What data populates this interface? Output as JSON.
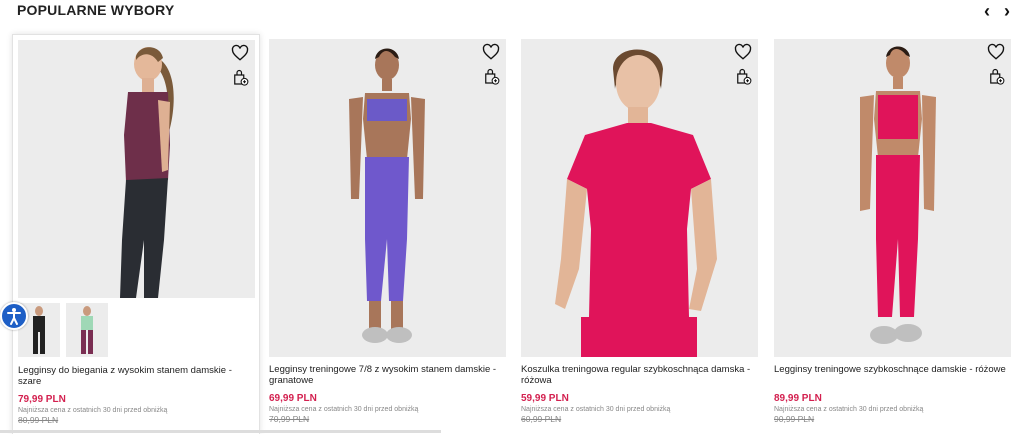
{
  "section": {
    "title": "POPULARNE WYBORY"
  },
  "nav": {
    "prev_icon": "chevron-left-icon",
    "next_icon": "chevron-right-icon"
  },
  "products": [
    {
      "name": "Legginsy do biegania z wysokim stanem damskie - szare",
      "price": "79,99 PLN",
      "lowest_note": "Najniższa cena z ostatnich 30 dni przed obniżką",
      "old_price": "80,99 PLN",
      "has_thumbs": true
    },
    {
      "name": "Legginsy treningowe 7/8 z wysokim stanem damskie - granatowe",
      "price": "69,99 PLN",
      "lowest_note": "Najniższa cena z ostatnich 30 dni przed obniżką",
      "old_price": "70,99 PLN"
    },
    {
      "name": "Koszulka treningowa regular szybkoschnąca damska - różowa",
      "price": "59,99 PLN",
      "lowest_note": "Najniższa cena z ostatnich 30 dni przed obniżką",
      "old_price": "60,99 PLN"
    },
    {
      "name": "Legginsy treningowe szybkoschnące damskie - różowe",
      "price": "89,99 PLN",
      "lowest_note": "Najniższa cena z ostatnich 30 dni przed obniżką",
      "old_price": "90,99 PLN"
    }
  ],
  "colors": {
    "price": "#d3204f",
    "accessibility": "#1e5fc6"
  }
}
